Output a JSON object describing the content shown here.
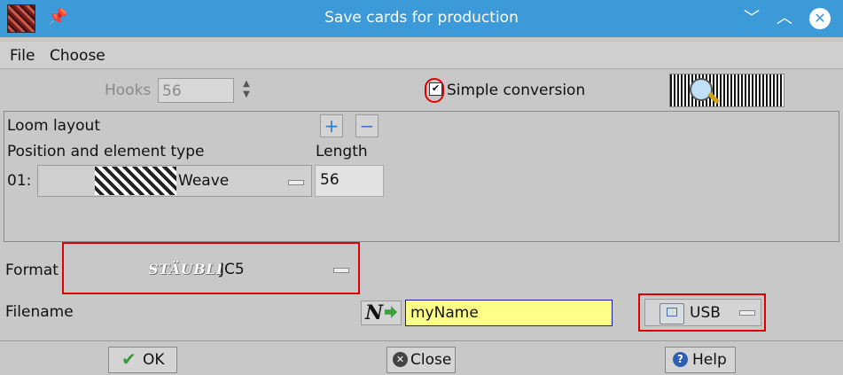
{
  "window": {
    "title": "Save cards for production"
  },
  "menu": {
    "file": "File",
    "choose": "Choose"
  },
  "hooks": {
    "label": "Hooks",
    "value": "56"
  },
  "simple_conversion": {
    "label": "Simple conversion",
    "checked": true
  },
  "loom": {
    "title": "Loom layout",
    "col_position": "Position and element type",
    "col_length": "Length",
    "rows": [
      {
        "index": "01:",
        "element": "Weave",
        "length": "56"
      }
    ]
  },
  "format": {
    "label": "Format",
    "brand": "STÄUBLI",
    "value": "JC5"
  },
  "filename": {
    "label": "Filename",
    "value": "myName",
    "target": "USB"
  },
  "buttons": {
    "ok": "OK",
    "close": "Close",
    "help": "Help"
  },
  "colors": {
    "titlebar": "#3c9ad9",
    "highlight": "#e00000",
    "filename_bg": "#ffff88"
  }
}
